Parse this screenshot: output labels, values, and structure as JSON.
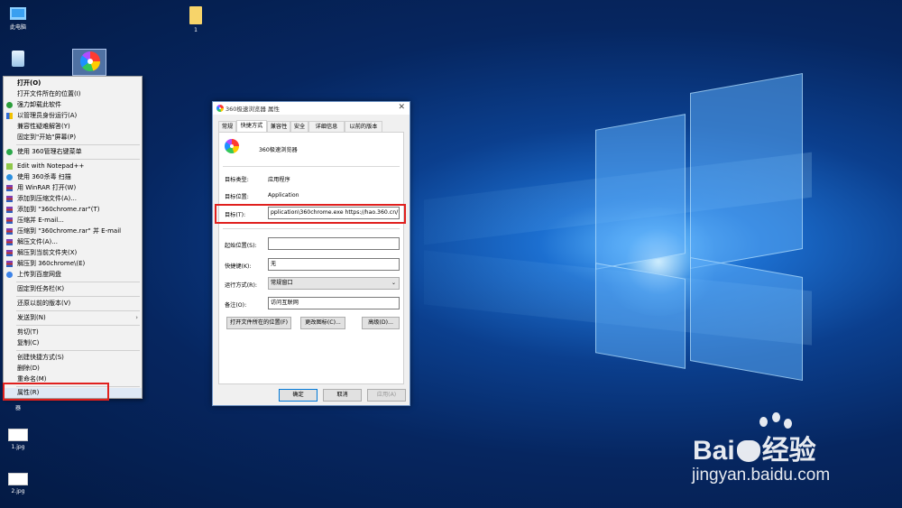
{
  "desktop": {
    "icons": [
      {
        "label": "此电脑"
      },
      {
        "label": "1"
      },
      {
        "label": "1.jpg"
      },
      {
        "label": "2.jpg"
      },
      {
        "label": "器"
      }
    ]
  },
  "context_menu": {
    "items": [
      {
        "label": "打开(O)"
      },
      {
        "label": "打开文件所在的位置(I)"
      },
      {
        "label": "强力卸载此软件"
      },
      {
        "label": "以管理员身份运行(A)"
      },
      {
        "label": "兼容性疑难解答(Y)"
      },
      {
        "label": "固定到\"开始\"屏幕(P)"
      },
      {
        "label": "使用 360管理右键菜单"
      },
      {
        "label": "Edit with Notepad++"
      },
      {
        "label": "使用 360杀毒 扫描"
      },
      {
        "label": "用 WinRAR 打开(W)"
      },
      {
        "label": "添加到压缩文件(A)..."
      },
      {
        "label": "添加到 \"360chrome.rar\"(T)"
      },
      {
        "label": "压缩并 E-mail..."
      },
      {
        "label": "压缩到 \"360chrome.rar\" 并 E-mail"
      },
      {
        "label": "解压文件(A)..."
      },
      {
        "label": "解压到当前文件夹(X)"
      },
      {
        "label": "解压到 360chrome\\(E)"
      },
      {
        "label": "上传到百度网盘"
      },
      {
        "label": "固定到任务栏(K)"
      },
      {
        "label": "还原以前的版本(V)"
      },
      {
        "label": "发送到(N)"
      },
      {
        "label": "剪切(T)"
      },
      {
        "label": "复制(C)"
      },
      {
        "label": "创建快捷方式(S)"
      },
      {
        "label": "删除(D)"
      },
      {
        "label": "重命名(M)"
      },
      {
        "label": "属性(R)"
      }
    ]
  },
  "dialog": {
    "title": "360极速浏览器 属性",
    "close": "✕",
    "tabs": [
      "常规",
      "快捷方式",
      "兼容性",
      "安全",
      "详细信息",
      "以前的版本"
    ],
    "app_name": "360极速浏览器",
    "target_type_label": "目标类型:",
    "target_type_value": "应用程序",
    "target_location_label": "目标位置:",
    "target_location_value": "Application",
    "target_label": "目标(T):",
    "target_value": "pplication\\360chrome.exe https://hao.360.cn/?s",
    "start_in_label": "起始位置(S):",
    "start_in_value": "",
    "shortcut_key_label": "快捷键(K):",
    "shortcut_key_value": "无",
    "run_label": "运行方式(R):",
    "run_value": "常规窗口",
    "comment_label": "备注(O):",
    "comment_value": "访问互联网",
    "open_location_button": "打开文件所在的位置(F)",
    "change_icon_button": "更改图标(C)...",
    "advanced_button": "高级(D)...",
    "ok_button": "确定",
    "cancel_button": "取消",
    "apply_button": "应用(A)"
  },
  "watermark": {
    "brand_pre": "Bai",
    "brand_post": "经验",
    "url": "jingyan.baidu.com"
  },
  "colors": {
    "highlight_box": "#e0201e",
    "desktop_blue": "#0b3f8e"
  }
}
